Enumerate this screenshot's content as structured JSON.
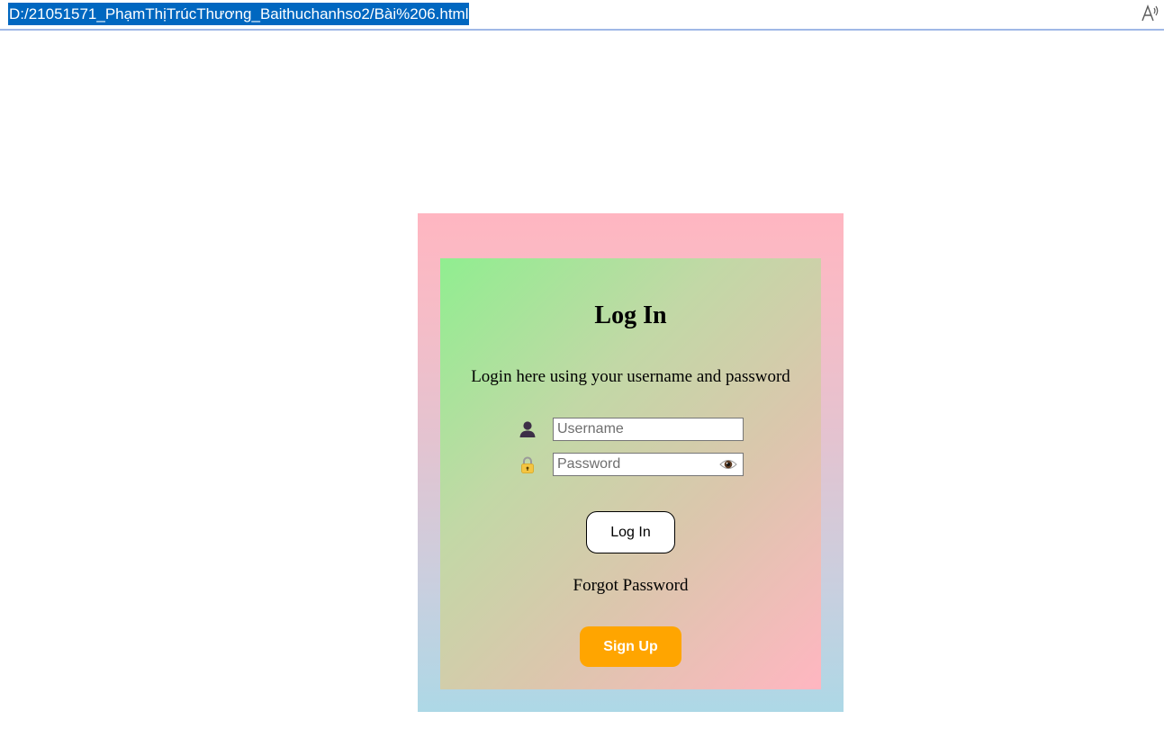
{
  "browser": {
    "url": "D:/21051571_PhạmThịTrúcThương_Baithuchanhso2/Bài%206.html"
  },
  "login_form": {
    "title": "Log In",
    "subtitle": "Login here using your username and password",
    "username_placeholder": "Username",
    "password_placeholder": "Password",
    "login_button": "Log In",
    "forgot_password": "Forgot Password",
    "signup_button": "Sign Up"
  },
  "icons": {
    "user": "user-silhouette-icon",
    "password": "lock-icon",
    "toggle_password": "eye-icon",
    "read_aloud": "read-aloud-icon"
  },
  "colors": {
    "outer_gradient_top": "#ffb6c1",
    "outer_gradient_bottom": "#add8e6",
    "inner_gradient_start": "#90ee90",
    "inner_gradient_end": "#ffb6c1",
    "signup_button": "#ffa500",
    "url_highlight": "#0067c0"
  }
}
